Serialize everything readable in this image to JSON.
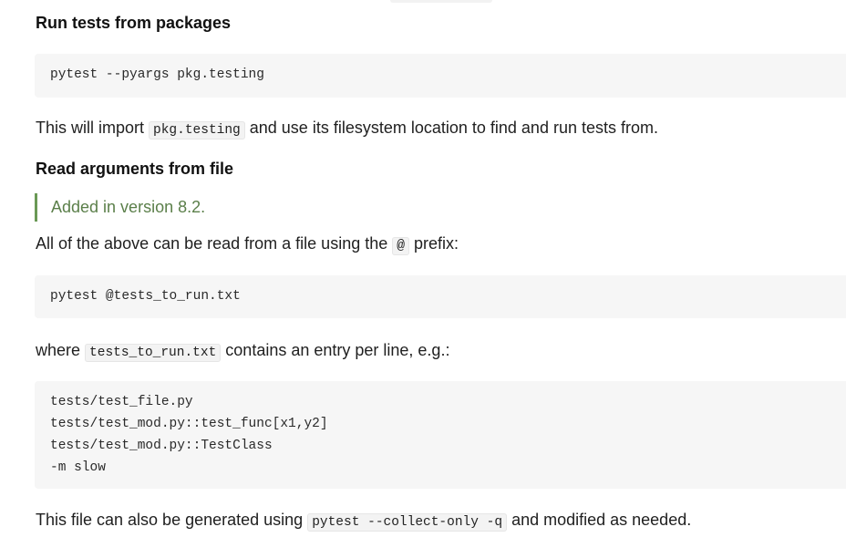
{
  "section1": {
    "heading": "Run tests from packages",
    "code": "pytest --pyargs pkg.testing",
    "para_before": "This will import",
    "para_code": "pkg.testing",
    "para_after": "and use its filesystem location to find and run tests from."
  },
  "section2": {
    "heading": "Read arguments from file",
    "note": "Added in version 8.2.",
    "para1_before": "All of the above can be read from a file using the",
    "para1_code": "@",
    "para1_after": "prefix:",
    "code1": "pytest @tests_to_run.txt",
    "para2_before": "where",
    "para2_code": "tests_to_run.txt",
    "para2_after": "contains an entry per line, e.g.:",
    "code2_lines": [
      "tests/test_file.py",
      "tests/test_mod.py::test_func[x1,y2]",
      "tests/test_mod.py::TestClass",
      "-m slow"
    ],
    "para3_before": "This file can also be generated using",
    "para3_code": "pytest --collect-only -q",
    "para3_after": "and modified as needed."
  }
}
